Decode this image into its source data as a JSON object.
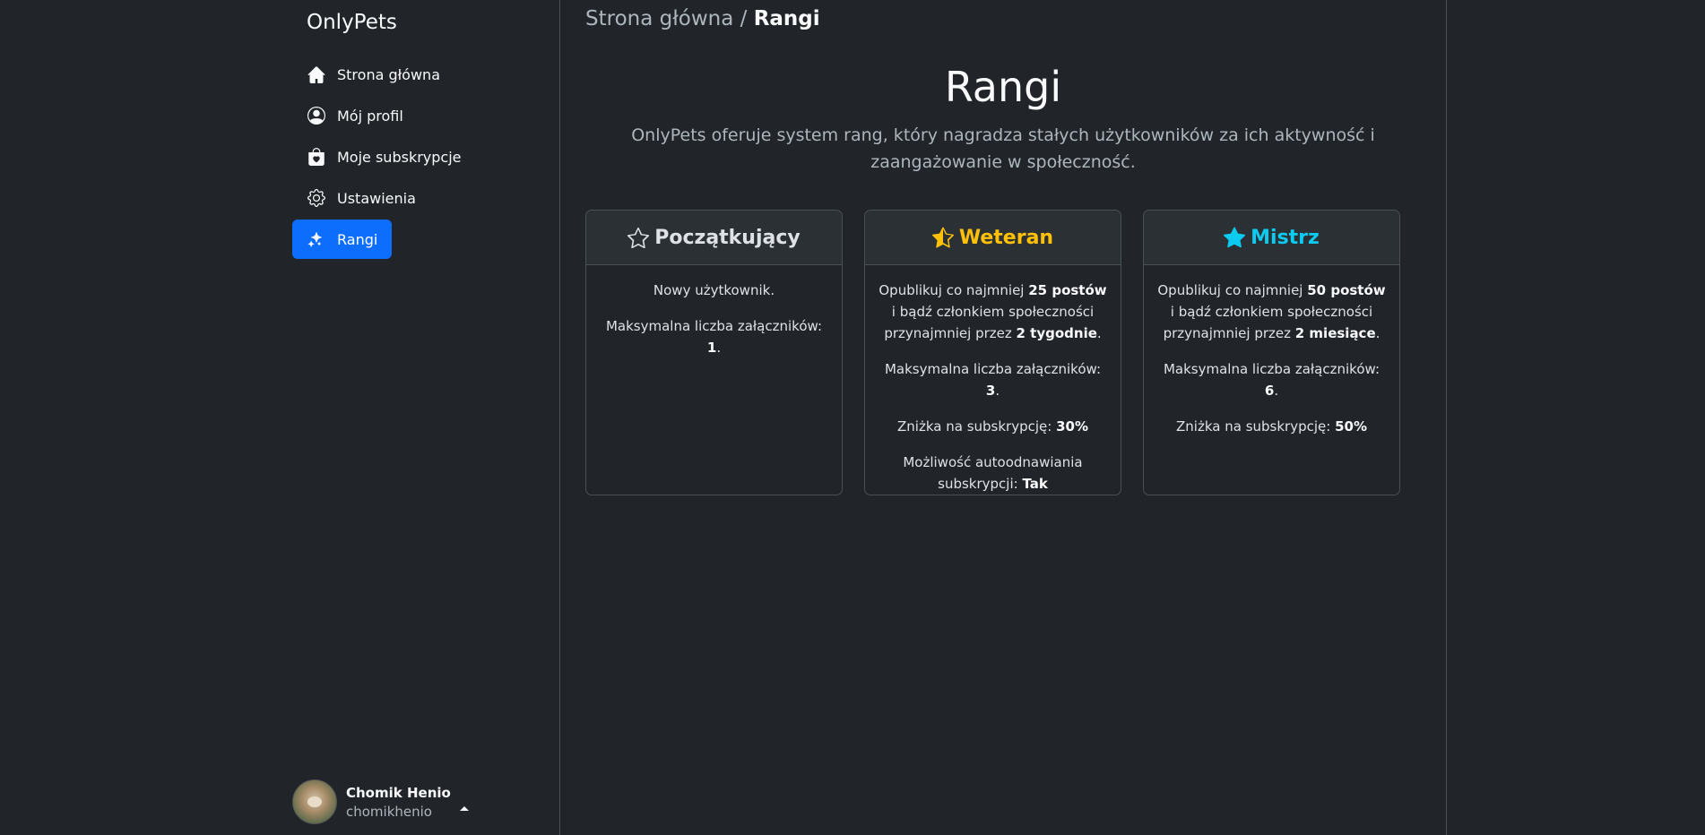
{
  "brand": "OnlyPets",
  "nav": [
    {
      "label": "Strona główna",
      "icon": "house-icon"
    },
    {
      "label": "Mój profil",
      "icon": "person-circle-icon"
    },
    {
      "label": "Moje subskrypcje",
      "icon": "bag-heart-icon"
    },
    {
      "label": "Ustawienia",
      "icon": "gear-icon"
    },
    {
      "label": "Rangi",
      "icon": "stars-icon",
      "active": true
    }
  ],
  "user": {
    "name": "Chomik Henio",
    "handle": "chomikhenio"
  },
  "breadcrumb": {
    "home": "Strona główna",
    "separator": "/",
    "current": "Rangi"
  },
  "title": "Rangi",
  "lead": "OnlyPets oferuje system rang, który nagradza stałych użytkowników za ich aktywność i zaangażowanie w społeczność.",
  "colors": {
    "accent": "#0d6efd",
    "weteran": "#ffc107",
    "mistrz": "#0dcaf0",
    "poczatkujacy": "#dee2e6"
  },
  "ranks": [
    {
      "name": "Początkujący",
      "icon": "star-outline-icon",
      "p1": "Nowy użytkownik.",
      "attach_label": "Maksymalna liczba załączników: ",
      "attach_value": "1",
      "attach_end": "."
    },
    {
      "name": "Weteran",
      "icon": "star-half-icon",
      "req_pre": "Opublikuj co najmniej ",
      "req_posts": "25 postów",
      "req_mid": " i bądź członkiem społeczności przynajmniej przez ",
      "req_time": "2 tygodnie",
      "req_end": ".",
      "attach_label": "Maksymalna liczba załączników: ",
      "attach_value": "3",
      "attach_end": ".",
      "discount_label": "Zniżka na subskrypcję: ",
      "discount_value": "30%",
      "renew_label": "Możliwość autoodnawiania subskrypcji: ",
      "renew_value": "Tak"
    },
    {
      "name": "Mistrz",
      "icon": "star-fill-icon",
      "req_pre": "Opublikuj co najmniej ",
      "req_posts": "50 postów",
      "req_mid": " i bądź członkiem społeczności przynajmniej przez ",
      "req_time": "2 miesiące",
      "req_end": ".",
      "attach_label": "Maksymalna liczba załączników: ",
      "attach_value": "6",
      "attach_end": ".",
      "discount_label": "Zniżka na subskrypcję: ",
      "discount_value": "50%"
    }
  ]
}
